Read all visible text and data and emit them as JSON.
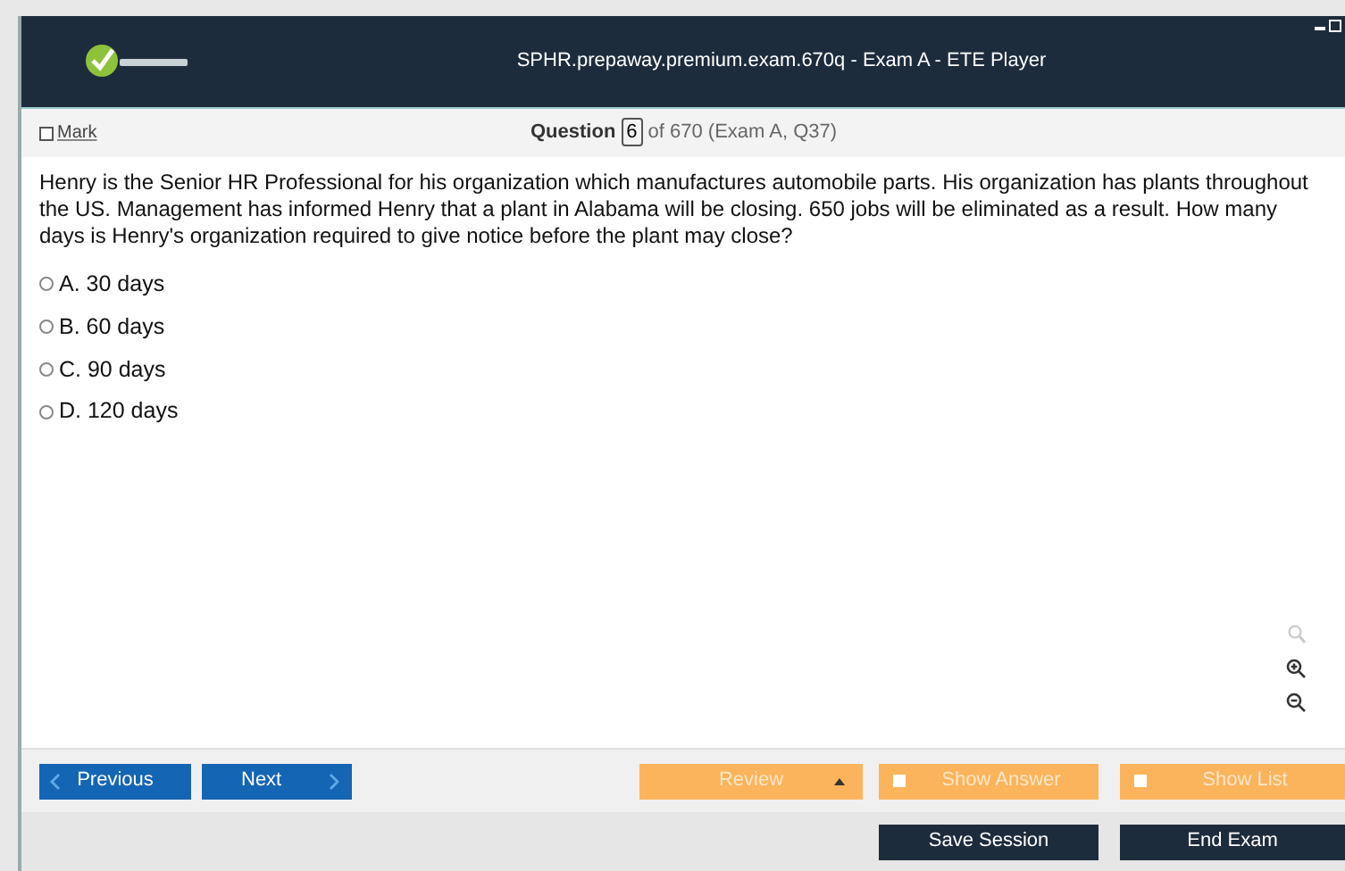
{
  "window": {
    "title": "SPHR.prepaway.premium.exam.670q - Exam A - ETE Player"
  },
  "mark": {
    "label": "Mark",
    "checked": false
  },
  "question_nav": {
    "label": "Question",
    "number": "6",
    "suffix": "of 670 (Exam A, Q37)"
  },
  "question": "Henry is the Senior HR Professional for his organization which manufactures automobile parts. His organization has plants throughout the US. Management has informed Henry that a plant in Alabama will be closing. 650 jobs will be eliminated as a result. How many days is Henry's organization required to give notice before the plant may close?",
  "options": [
    {
      "label": "A. 30 days",
      "selected": false
    },
    {
      "label": "B. 60 days",
      "selected": false
    },
    {
      "label": "C. 90 days",
      "selected": false
    },
    {
      "label": "D. 120 days",
      "selected": false
    }
  ],
  "toolbar": {
    "previous": "Previous",
    "next": "Next",
    "review": "Review",
    "toggles": [
      {
        "label": "Show Answer",
        "checked": false
      },
      {
        "label": "Show List",
        "checked": false
      }
    ]
  },
  "footer": [
    "Save Session",
    "End Exam"
  ]
}
